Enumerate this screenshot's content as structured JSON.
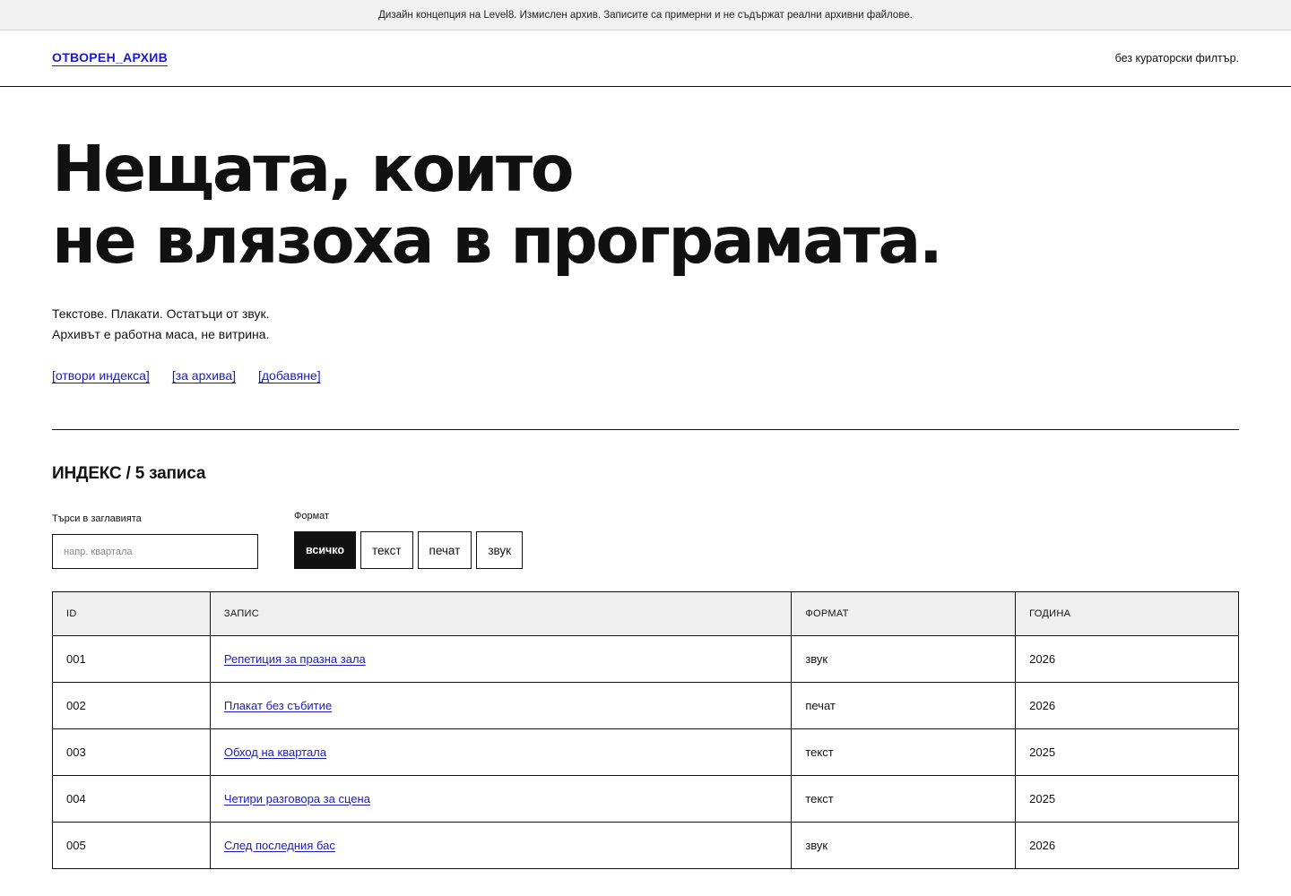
{
  "notice": "Дизайн концепция на Level8. Измислен архив. Записите са примерни и не съдържат реални архивни файлове.",
  "header": {
    "logo": "ОТВОРЕН_АРХИВ",
    "note": "без кураторски филтър."
  },
  "hero": {
    "title_line1": "Нещата, които",
    "title_line2": "не влязоха в програмата.",
    "sub_line1": "Текстове. Плакати. Остатъци от звук.",
    "sub_line2": "Архивът е работна маса, не витрина.",
    "links": [
      "[отвори индекса]",
      "[за архива]",
      "[добавяне]"
    ]
  },
  "index": {
    "title": "ИНДЕКС / 5 записа",
    "search": {
      "label": "Търси в заглавията",
      "placeholder": "напр. квартала",
      "value": ""
    },
    "format": {
      "label": "Формат",
      "options": [
        "всичко",
        "текст",
        "печат",
        "звук"
      ],
      "selected": "всичко"
    },
    "table": {
      "headers": [
        "ID",
        "ЗАПИС",
        "ФОРМАТ",
        "ГОДИНА"
      ],
      "rows": [
        {
          "id": "001",
          "title": "Репетиция за празна зала",
          "format": "звук",
          "year": "2026"
        },
        {
          "id": "002",
          "title": "Плакат без събитие",
          "format": "печат",
          "year": "2026"
        },
        {
          "id": "003",
          "title": "Обход на квартала",
          "format": "текст",
          "year": "2025"
        },
        {
          "id": "004",
          "title": "Четири разговора за сцена",
          "format": "текст",
          "year": "2025"
        },
        {
          "id": "005",
          "title": "След последния бас",
          "format": "звук",
          "year": "2026"
        }
      ]
    }
  },
  "colors": {
    "link": "#1a1acc",
    "text": "#111111",
    "notice_bg": "#f1f1f1",
    "table_header_bg": "#efefef"
  }
}
